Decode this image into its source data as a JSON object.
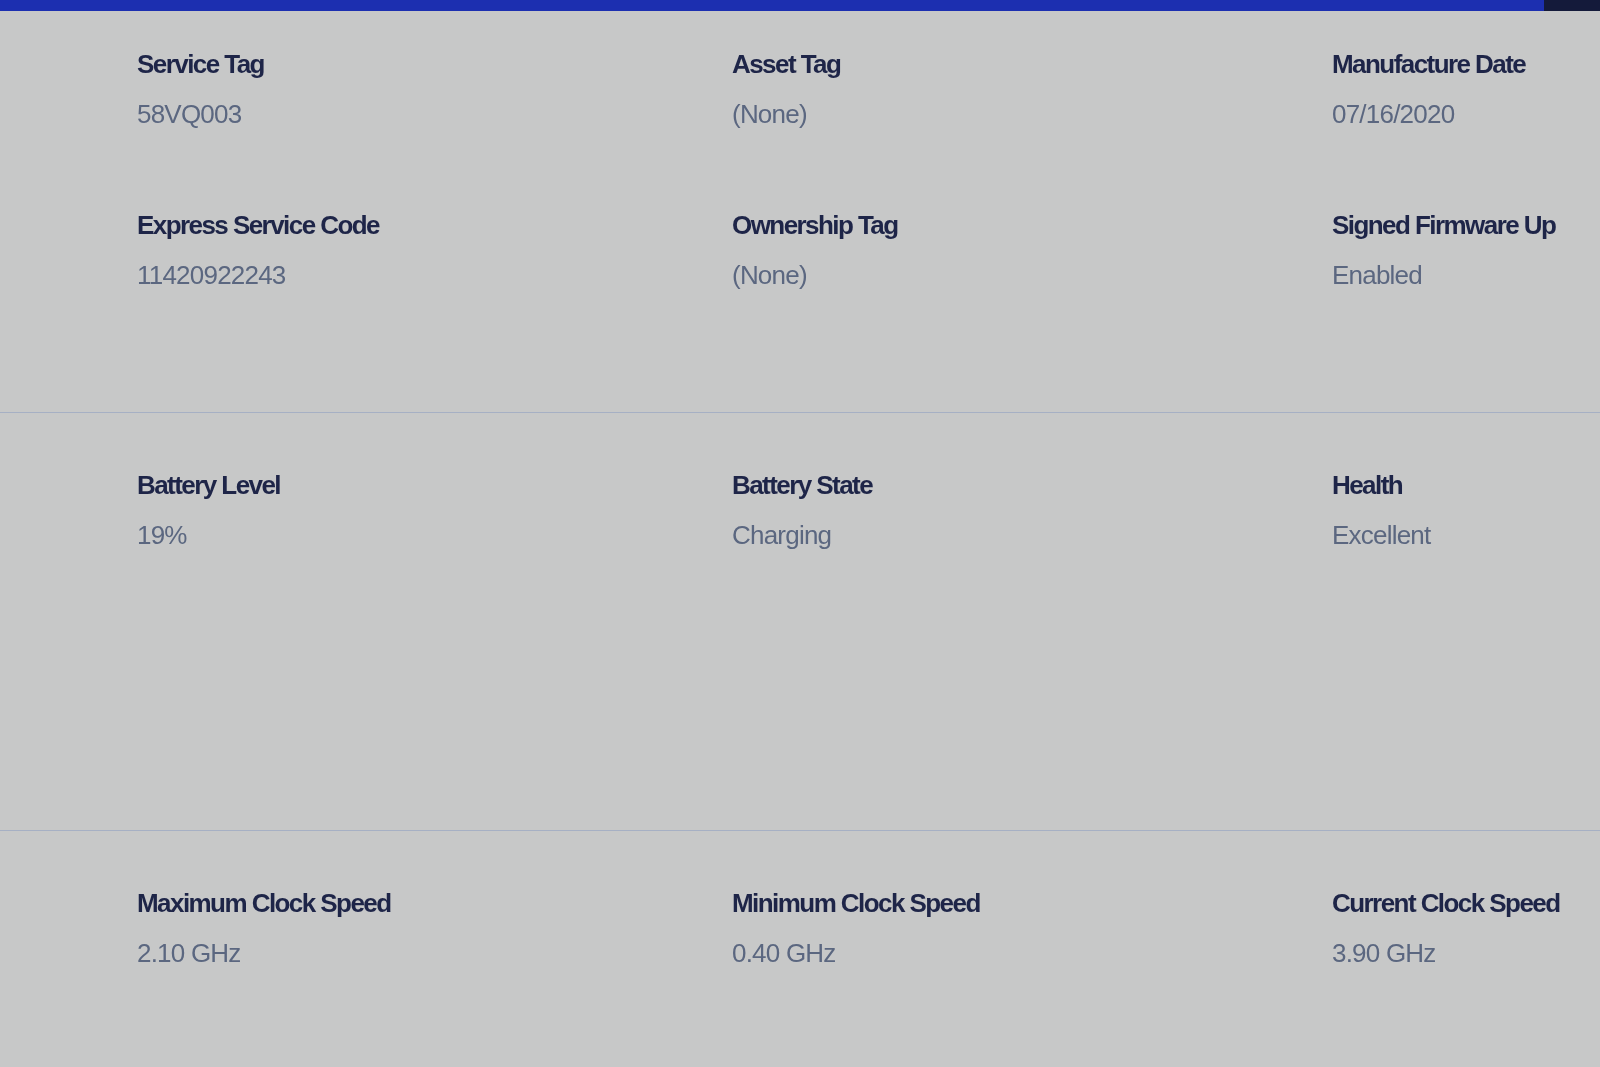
{
  "sections": [
    {
      "fields": [
        {
          "label": "Service Tag",
          "value": "58VQ003"
        },
        {
          "label": "Asset Tag",
          "value": "(None)"
        },
        {
          "label": "Manufacture Date",
          "value": "07/16/2020"
        },
        {
          "label": "Express Service Code",
          "value": "11420922243"
        },
        {
          "label": "Ownership Tag",
          "value": "(None)"
        },
        {
          "label": "Signed Firmware Up",
          "value": "Enabled"
        }
      ]
    },
    {
      "fields": [
        {
          "label": "Battery Level",
          "value": "19%"
        },
        {
          "label": "Battery State",
          "value": "Charging"
        },
        {
          "label": "Health",
          "value": "Excellent"
        }
      ]
    },
    {
      "fields": [
        {
          "label": "Maximum Clock Speed",
          "value": "2.10 GHz"
        },
        {
          "label": "Minimum Clock Speed",
          "value": "0.40 GHz"
        },
        {
          "label": "Current Clock Speed",
          "value": "3.90 GHz"
        }
      ]
    }
  ]
}
